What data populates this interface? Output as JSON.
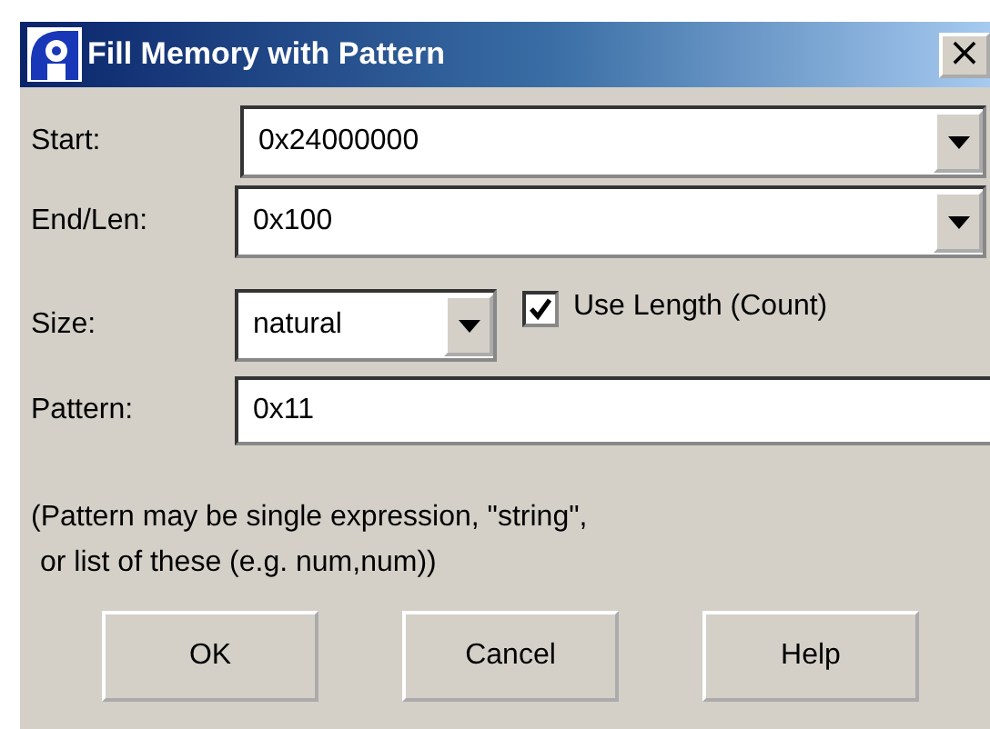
{
  "window": {
    "title": "Fill Memory with Pattern",
    "close": "×"
  },
  "fields": [
    {
      "label": "Start:",
      "kind": "combo",
      "value": "0x24000000"
    },
    {
      "label": "End/Len:",
      "kind": "combo",
      "value": "0x100"
    },
    {
      "label": "Size:",
      "kind": "small-combo",
      "value": "natural"
    },
    {
      "label": "Pattern:",
      "kind": "text",
      "value": "0x11"
    }
  ],
  "checkbox": {
    "label": "Use Length (Count)",
    "checked": true
  },
  "note": [
    "(Pattern may be single expression, \"string\",",
    "or list of these (e.g. num,num))"
  ],
  "buttons": [
    "OK",
    "Cancel",
    "Help"
  ]
}
